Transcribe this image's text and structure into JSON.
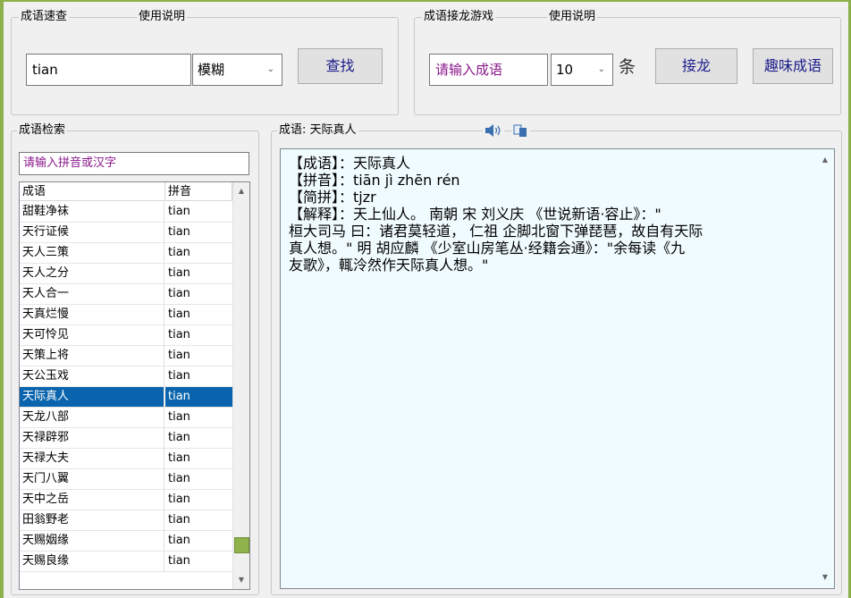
{
  "search_group": {
    "legend": "成语速查",
    "help_label": "使用说明",
    "query_value": "tian",
    "mode_value": "模糊",
    "find_button": "查找"
  },
  "game_group": {
    "legend": "成语接龙游戏",
    "help_label": "使用说明",
    "input_placeholder": "请输入成语",
    "count_value": "10",
    "count_unit": "条",
    "chain_button": "接龙",
    "fun_button": "趣味成语"
  },
  "index_group": {
    "legend": "成语检索",
    "search_placeholder": "请输入拼音或汉字",
    "columns": [
      "成语",
      "拼音"
    ],
    "rows": [
      {
        "idiom": "甜鞋净袜",
        "pinyin": "tian"
      },
      {
        "idiom": "天行证候",
        "pinyin": "tian"
      },
      {
        "idiom": "天人三策",
        "pinyin": "tian"
      },
      {
        "idiom": "天人之分",
        "pinyin": "tian"
      },
      {
        "idiom": "天人合一",
        "pinyin": "tian"
      },
      {
        "idiom": "天真烂慢",
        "pinyin": "tian"
      },
      {
        "idiom": "天可怜见",
        "pinyin": "tian"
      },
      {
        "idiom": "天策上将",
        "pinyin": "tian"
      },
      {
        "idiom": "天公玉戏",
        "pinyin": "tian"
      },
      {
        "idiom": "天际真人",
        "pinyin": "tian"
      },
      {
        "idiom": "天龙八部",
        "pinyin": "tian"
      },
      {
        "idiom": "天禄辟邪",
        "pinyin": "tian"
      },
      {
        "idiom": "天禄大夫",
        "pinyin": "tian"
      },
      {
        "idiom": "天门八翼",
        "pinyin": "tian"
      },
      {
        "idiom": "天中之岳",
        "pinyin": "tian"
      },
      {
        "idiom": "田翁野老",
        "pinyin": "tian"
      },
      {
        "idiom": "天赐姻缘",
        "pinyin": "tian"
      },
      {
        "idiom": "天赐良缘",
        "pinyin": "tian"
      }
    ],
    "selected_index": 9,
    "scroll_position": 0.95
  },
  "detail_group": {
    "legend": "成语: 天际真人",
    "speaker_icon": "speaker-icon",
    "copy_icon": "copy-icon",
    "lines": [
      "【成语】：天际真人",
      "【拼音】：tiān jì zhēn rén",
      "【简拼】：tjzr",
      "【解释】：天上仙人。 南朝  宋  刘义庆 《世说新语·容止》：\"",
      "桓大司马 曰：诸君莫轻道，  仁祖 企脚北窗下弹琵琶，故自有天际",
      "真人想。\" 明  胡应麟 《少室山房笔丛·经籍会通》：\"余每读《九",
      "友歌》，輒泠然作天际真人想。\""
    ]
  },
  "colors": {
    "frame": "#8db04a",
    "selection": "#0a64ad",
    "detail_background": "#f0fbff",
    "placeholder_text": "#8b1a8b",
    "button_text": "#1b1b8a"
  }
}
